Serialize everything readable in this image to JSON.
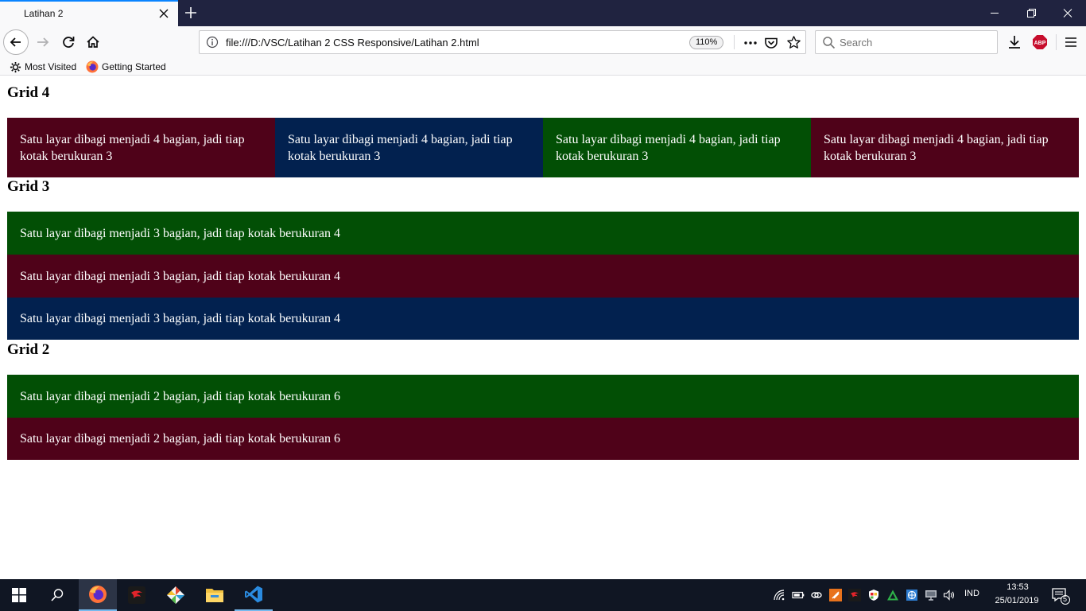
{
  "browser": {
    "tab": {
      "title": "Latihan 2"
    },
    "url": "file:///D:/VSC/Latihan 2 CSS Responsive/Latihan 2.html",
    "zoom": "110%",
    "search_placeholder": "Search",
    "bookmarks": [
      {
        "label": "Most Visited",
        "icon": "gear-icon"
      },
      {
        "label": "Getting Started",
        "icon": "firefox-icon"
      }
    ]
  },
  "page": {
    "grid4": {
      "heading": "Grid 4",
      "boxes": [
        {
          "text": "Satu layar dibagi menjadi 4 bagian, jadi tiap kotak berukuran 3",
          "color": "#4f0219"
        },
        {
          "text": "Satu layar dibagi menjadi 4 bagian, jadi tiap kotak berukuran 3",
          "color": "#02214f"
        },
        {
          "text": "Satu layar dibagi menjadi 4 bagian, jadi tiap kotak berukuran 3",
          "color": "#024f05"
        },
        {
          "text": "Satu layar dibagi menjadi 4 bagian, jadi tiap kotak berukuran 3",
          "color": "#4f0219"
        }
      ]
    },
    "grid3": {
      "heading": "Grid 3",
      "boxes": [
        {
          "text": "Satu layar dibagi menjadi 3 bagian, jadi tiap kotak berukuran 4",
          "color": "#024f05"
        },
        {
          "text": "Satu layar dibagi menjadi 3 bagian, jadi tiap kotak berukuran 4",
          "color": "#4f0219"
        },
        {
          "text": "Satu layar dibagi menjadi 3 bagian, jadi tiap kotak berukuran 4",
          "color": "#02214f"
        }
      ]
    },
    "grid2": {
      "heading": "Grid 2",
      "boxes": [
        {
          "text": "Satu layar dibagi menjadi 2 bagian, jadi tiap kotak berukuran 6",
          "color": "#024f05"
        },
        {
          "text": "Satu layar dibagi menjadi 2 bagian, jadi tiap kotak berukuran 6",
          "color": "#4f0219"
        }
      ]
    }
  },
  "taskbar": {
    "apps": [
      "windows-start-icon",
      "search-icon",
      "firefox-icon",
      "garena-icon",
      "git-icon",
      "file-explorer-icon",
      "vscode-icon"
    ],
    "language": "IND",
    "time": "13:53",
    "date": "25/01/2019",
    "notification_count": "5"
  }
}
